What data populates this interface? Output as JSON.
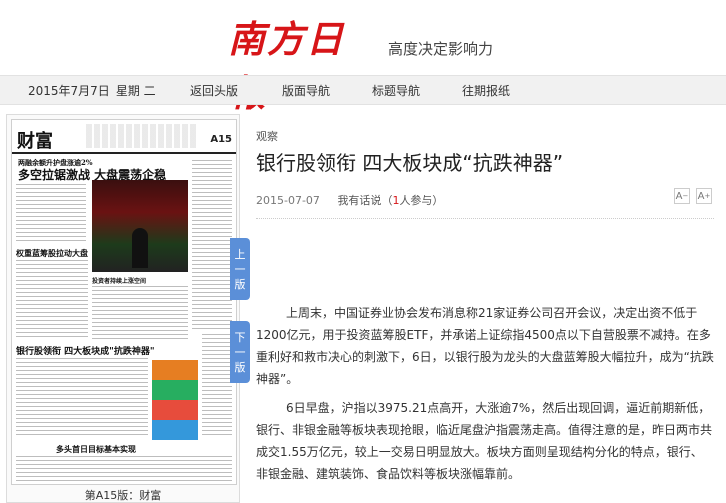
{
  "masthead": {
    "logo": "南方日報",
    "slogan": "高度决定影响力"
  },
  "nav": {
    "date": "2015年7月7日",
    "weekday": "星期 二",
    "links": [
      "返回头版",
      "版面导航",
      "标题导航",
      "往期报纸"
    ]
  },
  "page_preview": {
    "section": "财富",
    "page_no": "A15",
    "headlines": [
      "两融余额升护盘涨逾2%",
      "多空拉锯激战 大盘震荡企稳",
      "权重蓝筹股拉动大盘",
      "投资者持续上涨空间",
      "银行股领衔 四大板块成\"抗跌神器\"",
      "多头首日目标基本实现"
    ],
    "caption": "第A15版：财富"
  },
  "pager": {
    "prev": [
      "上",
      "一",
      "版"
    ],
    "next": [
      "下",
      "一",
      "版"
    ]
  },
  "article": {
    "kicker": "观察",
    "title": "银行股领衔 四大板块成“抗跌神器”",
    "date": "2015-07-07",
    "comment_label": "我有话说",
    "participants_prefix": "（",
    "participants_count": "1",
    "participants_suffix": "人参与）",
    "font_smaller": "A",
    "font_larger": "A",
    "paragraphs": [
      "上周末，中国证券业协会发布消息称21家证券公司召开会议，决定出资不低于1200亿元，用于投资蓝筹股ETF，并承诺上证综指4500点以下自营股票不减持。在多重利好和救市决心的刺激下，6日，以银行股为龙头的大盘蓝筹股大幅拉升，成为“抗跌神器”。",
      "6日早盘，沪指以3975.21点高开，大涨逾7%，然后出现回调，逼近前期新低，银行、非银金融等板块表现抢眼，临近尾盘沪指震荡走高。值得注意的是，昨日两市共成交1.55万亿元，较上一交易日明显放大。板块方面则呈现结构分化的特点，银行、非银金融、建筑装饰、食品饮料等板块涨幅靠前。"
    ]
  }
}
